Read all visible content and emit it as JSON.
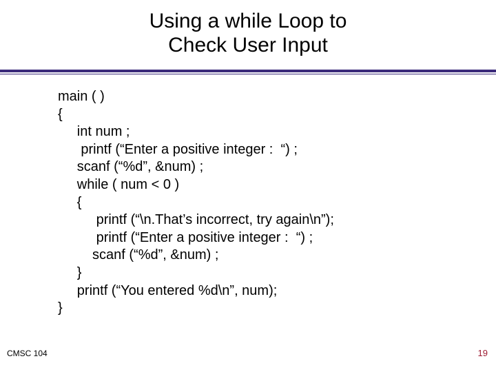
{
  "title": {
    "line1": "Using  a while Loop to",
    "line2": "Check User Input"
  },
  "code": {
    "l1": "main ( )",
    "l2": "{",
    "l3": "     int num ;",
    "l4": "      printf (“Enter a positive integer :  “) ;",
    "l5": "     scanf (“%d”, &num) ;",
    "l6": "     while ( num < 0 )",
    "l7": "     {",
    "l8": "          printf (“\\n.That’s incorrect, try again\\n”);",
    "l9": "          printf (“Enter a positive integer :  “) ;",
    "l10": "         scanf (“%d”, &num) ;",
    "l11": "     }",
    "l12": "     printf (“You entered %d\\n”, num);",
    "l13": "}"
  },
  "footer": {
    "left": "CMSC 104",
    "right": "19"
  }
}
